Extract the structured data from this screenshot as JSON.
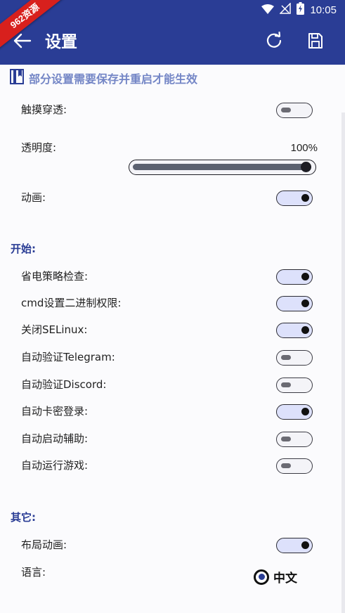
{
  "status_bar": {
    "time": "10:05"
  },
  "watermark": {
    "text": "962资源"
  },
  "app_bar": {
    "title": "设置"
  },
  "notice": "部分设置需要保存并重启才能生效",
  "general": {
    "touch_through": {
      "label": "触摸穿透:",
      "on": false
    },
    "opacity": {
      "label": "透明度:",
      "value_text": "100%",
      "value": 1.0
    },
    "animation": {
      "label": "动画:",
      "on": true
    }
  },
  "section_start": {
    "title": "开始:",
    "items": [
      {
        "label": "省电策略检查:",
        "on": true
      },
      {
        "label": "cmd设置二进制权限:",
        "on": true
      },
      {
        "label": "关闭SELinux:",
        "on": true
      },
      {
        "label": "自动验证Telegram:",
        "on": false
      },
      {
        "label": "自动验证Discord:",
        "on": false
      },
      {
        "label": "自动卡密登录:",
        "on": true
      },
      {
        "label": "自动启动辅助:",
        "on": false
      },
      {
        "label": "自动运行游戏:",
        "on": false
      }
    ]
  },
  "section_other": {
    "title": "其它:",
    "layout_animation": {
      "label": "布局动画:",
      "on": true
    },
    "language": {
      "label": "语言:",
      "selected": "中文"
    }
  }
}
